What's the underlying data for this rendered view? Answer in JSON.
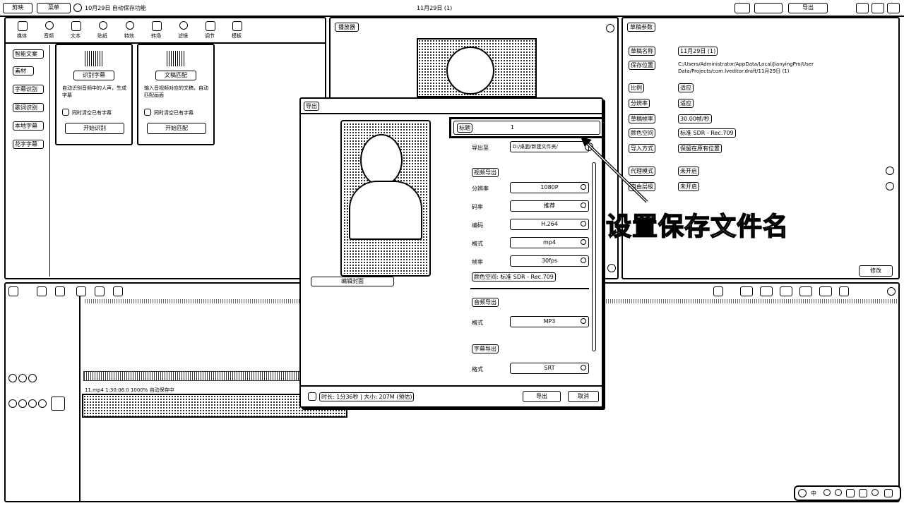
{
  "titlebar": {
    "app_name": "剪映",
    "menu_label": "菜单",
    "project_name": "10月29日 自动保存功能",
    "center_title": "11月29日 (1)",
    "right_btn1": "",
    "right_btn2": "",
    "right_btn3": "",
    "export_label": "导出"
  },
  "toolbar": {
    "items": [
      "媒体",
      "音频",
      "文本",
      "贴纸",
      "特效",
      "转场",
      "滤镜",
      "调节",
      "模板"
    ]
  },
  "sidebar": {
    "items": [
      "智能文案",
      "素材",
      "字幕识别",
      "歌词识别",
      "本地字幕",
      "花字字幕"
    ]
  },
  "cards": [
    {
      "title": "识别字幕",
      "desc": "自动识别音频中的人声，生成字幕",
      "check": "同时清空已有字幕",
      "button": "开始识别"
    },
    {
      "title": "文稿匹配",
      "desc": "输入音视频对应的文稿，自动匹配画面",
      "check": "同时清空已有字幕",
      "button": "开始匹配"
    }
  ],
  "player": {
    "title": "播放器"
  },
  "props": {
    "title": "草稿参数",
    "rows": [
      {
        "k": "草稿名称",
        "v": "11月29日 (1)"
      },
      {
        "k": "保存位置",
        "v": "C:/Users/Administrator/AppData/Local/JianyingPro/User Data/Projects/com.lveditor.draft/11月29日 (1)"
      },
      {
        "k": "比例",
        "v": "适应"
      },
      {
        "k": "分辨率",
        "v": "适应"
      },
      {
        "k": "草稿帧率",
        "v": "30.00帧/秒"
      },
      {
        "k": "颜色空间",
        "v": "标准 SDR - Rec.709"
      },
      {
        "k": "导入方式",
        "v": "保留在原有位置"
      },
      {
        "k": "代理模式",
        "v": "未开启"
      },
      {
        "k": "自由层级",
        "v": "未开启"
      }
    ],
    "modify": "修改"
  },
  "export_dialog": {
    "title": "导出",
    "edit_cover": "编辑封面",
    "fields": {
      "name_label": "标题",
      "name_value": "1",
      "path_label": "导出至",
      "path_value": "D:/桌面/新建文件夹/"
    },
    "sections": [
      {
        "label": "视频导出",
        "rows": [
          {
            "k": "分辨率",
            "v": "1080P"
          },
          {
            "k": "码率",
            "v": "推荐"
          },
          {
            "k": "编码",
            "v": "H.264"
          },
          {
            "k": "格式",
            "v": "mp4"
          },
          {
            "k": "帧率",
            "v": "30fps"
          }
        ],
        "color": "颜色空间: 标准 SDR - Rec.709"
      },
      {
        "label": "音频导出",
        "rows": [
          {
            "k": "格式",
            "v": "MP3"
          }
        ]
      },
      {
        "label": "字幕导出",
        "rows": [
          {
            "k": "格式",
            "v": "SRT"
          }
        ]
      }
    ],
    "footer_info": "时长: 1分36秒 | 大小: 207M (预估)",
    "export_btn": "导出",
    "cancel_btn": "取消"
  },
  "annotation": {
    "text": "设置保存文件名"
  },
  "timeline": {
    "clip_label": "11.mp4  1:30:06.0  1000%  自动保存中"
  },
  "taskbar": {
    "ime": "中"
  }
}
